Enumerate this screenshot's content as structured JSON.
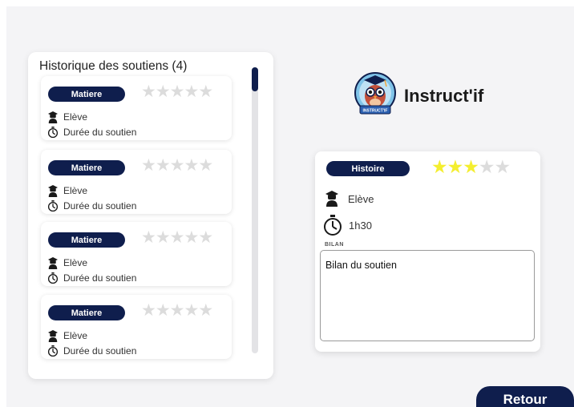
{
  "history": {
    "title": "Historique des soutiens (4)",
    "items": [
      {
        "subject": "Matiere",
        "rating": 0,
        "max_rating": 5,
        "student_label": "Elève",
        "duration_label": "Durée du soutien"
      },
      {
        "subject": "Matiere",
        "rating": 0,
        "max_rating": 5,
        "student_label": "Elève",
        "duration_label": "Durée du soutien"
      },
      {
        "subject": "Matiere",
        "rating": 0,
        "max_rating": 5,
        "student_label": "Elève",
        "duration_label": "Durée du soutien"
      },
      {
        "subject": "Matiere",
        "rating": 0,
        "max_rating": 5,
        "student_label": "Elève",
        "duration_label": "Durée du soutien"
      }
    ]
  },
  "brand": {
    "name": "Instruct'if",
    "logo_icon": "owl-graduate-logo",
    "logo_text": "INSTRUCT'IF"
  },
  "detail": {
    "subject": "Histoire",
    "rating": 3,
    "max_rating": 5,
    "student_label": "Elève",
    "duration": "1h30",
    "bilan_label": "BILAN",
    "bilan_text": "Bilan du soutien"
  },
  "actions": {
    "retour_label": "Retour"
  },
  "colors": {
    "navy": "#0f1e4d",
    "star_filled": "#f4ee2f",
    "star_empty": "#dcdcdc",
    "background": "#f4f4f6"
  },
  "icons": {
    "student": "student-icon",
    "duration": "stopwatch-icon"
  }
}
